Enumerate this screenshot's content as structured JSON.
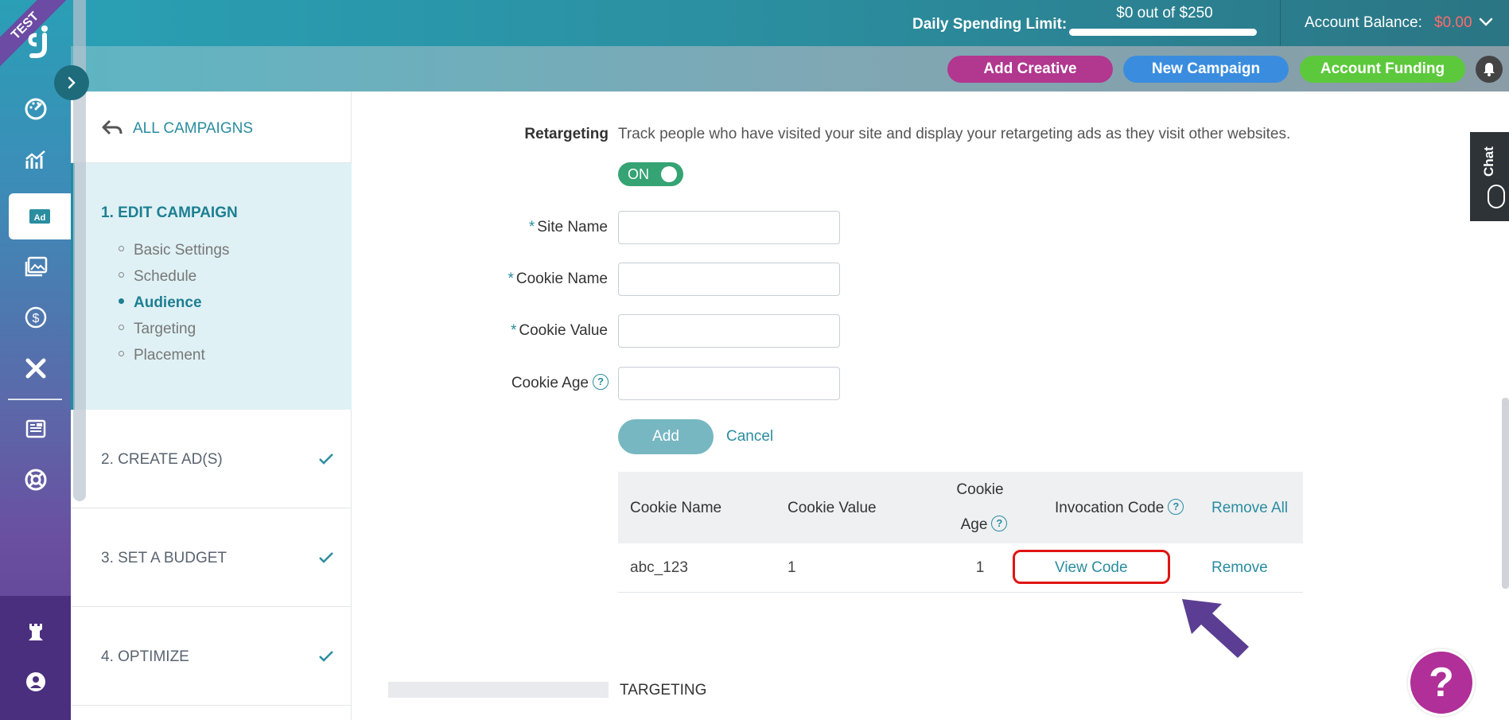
{
  "rail": {
    "badge": "TEST",
    "logo": "sj",
    "icons": [
      "dashboard-icon",
      "analytics-icon",
      "ad-icon",
      "gallery-icon",
      "dollar-icon",
      "tools-icon",
      "news-icon",
      "support-icon",
      "tower-icon",
      "user-icon"
    ],
    "ad_label": "Ad"
  },
  "topbar": {
    "spend_label": "Daily Spending Limit:",
    "spend_value": "$0 out of $250",
    "balance_label": "Account Balance:",
    "balance_value": "$0.00",
    "add_creative": "Add Creative",
    "new_campaign": "New Campaign",
    "account_funding": "Account Funding"
  },
  "steps": {
    "all_campaigns": "ALL CAMPAIGNS",
    "step1_title": "1. EDIT CAMPAIGN",
    "substeps": [
      "Basic Settings",
      "Schedule",
      "Audience",
      "Targeting",
      "Placement"
    ],
    "active_substep": "Audience",
    "step2_title": "2. CREATE AD(S)",
    "step3_title": "3. SET A BUDGET",
    "step4_title": "4. OPTIMIZE"
  },
  "retargeting": {
    "label": "Retargeting",
    "description": "Track people who have visited your site and display your retargeting ads as they visit other websites.",
    "toggle": "ON",
    "site_name_label": "Site Name",
    "cookie_name_label": "Cookie Name",
    "cookie_value_label": "Cookie Value",
    "cookie_age_label": "Cookie Age",
    "required_mark": "*",
    "add_button": "Add",
    "cancel": "Cancel"
  },
  "table": {
    "headers": {
      "cookie_name": "Cookie Name",
      "cookie_value": "Cookie Value",
      "cookie_age_1": "Cookie",
      "cookie_age_2": "Age",
      "invocation_code": "Invocation Code",
      "remove_all": "Remove All"
    },
    "rows": [
      {
        "cookie_name": "abc_123",
        "cookie_value": "1",
        "cookie_age": "1",
        "view_code": "View Code",
        "remove": "Remove"
      }
    ]
  },
  "targeting": {
    "title": "TARGETING"
  },
  "chat": {
    "label": "Chat"
  },
  "help_fab": "?",
  "colors": {
    "brand_teal": "#2a8da0",
    "balance_red": "#ff6b6b",
    "toggle_green": "#35a373",
    "add_creative": "#b1378f",
    "new_campaign": "#3a8dde",
    "account_funding": "#5cc93c",
    "highlight_red": "#e01414",
    "arrow_purple": "#5b3e93"
  }
}
